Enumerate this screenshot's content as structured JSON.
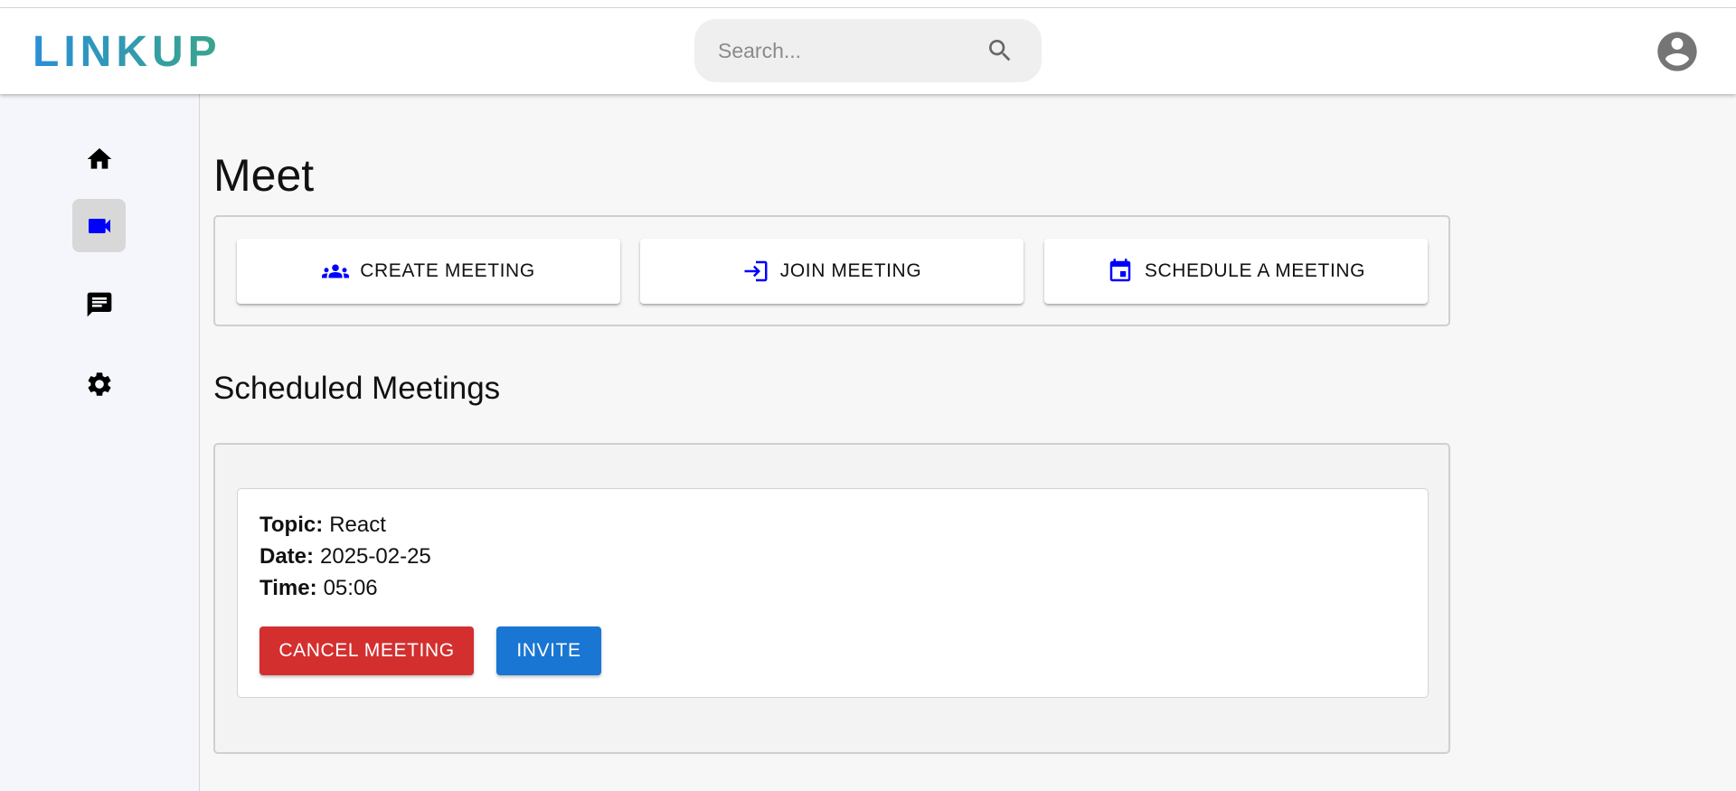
{
  "header": {
    "logo_text": "LINKUP",
    "search_placeholder": "Search...",
    "search_icon": "search-icon",
    "profile_icon": "account-circle-icon"
  },
  "sidebar": {
    "items": [
      {
        "name": "home",
        "icon": "home-icon",
        "active": false
      },
      {
        "name": "meet",
        "icon": "videocam-icon",
        "active": true
      },
      {
        "name": "chat",
        "icon": "chat-icon",
        "active": false
      },
      {
        "name": "settings",
        "icon": "gear-icon",
        "active": false
      }
    ]
  },
  "main": {
    "title": "Meet",
    "actions": [
      {
        "label": "CREATE MEETING",
        "icon": "groups-icon"
      },
      {
        "label": "JOIN MEETING",
        "icon": "login-icon"
      },
      {
        "label": "SCHEDULE A MEETING",
        "icon": "calendar-icon"
      }
    ],
    "scheduled_title": "Scheduled Meetings",
    "meetings": [
      {
        "topic_label": "Topic:",
        "topic": "React",
        "date_label": "Date:",
        "date": "2025-02-25",
        "time_label": "Time:",
        "time": "05:06",
        "cancel_label": "CANCEL MEETING",
        "invite_label": "INVITE"
      }
    ]
  },
  "colors": {
    "accent_icon": "#0000ff",
    "cancel": "#d32f2f",
    "invite": "#1976d2",
    "logo_start": "#2a8fd6",
    "logo_end": "#3aa58a"
  }
}
